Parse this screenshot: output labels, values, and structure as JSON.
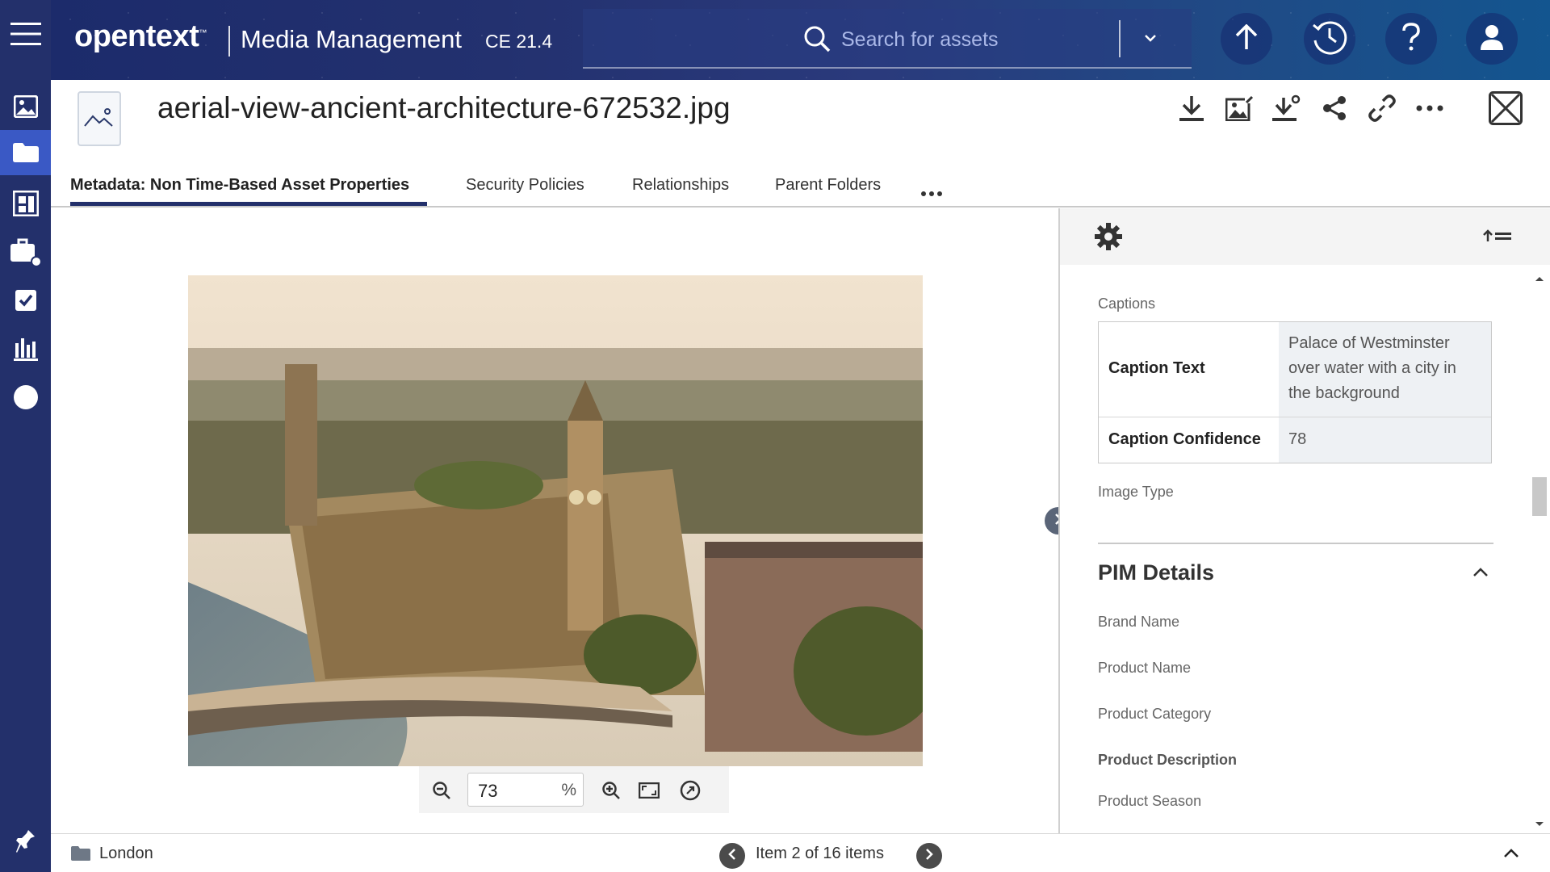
{
  "app": {
    "brand": "opentext",
    "brand_tm": "™",
    "product": "Media Management",
    "version": "CE 21.4"
  },
  "search": {
    "placeholder": "Search for assets"
  },
  "asset": {
    "title": "aerial-view-ancient-architecture-672532.jpg"
  },
  "tabs": [
    {
      "label": "Metadata: Non Time-Based Asset Properties",
      "active": true
    },
    {
      "label": "Security Policies"
    },
    {
      "label": "Relationships"
    },
    {
      "label": "Parent Folders"
    }
  ],
  "viewer": {
    "zoom_value": "73",
    "zoom_unit": "%"
  },
  "panel": {
    "captions_label": "Captions",
    "caption_rows": [
      {
        "key": "Caption Text",
        "value_lines": [
          "Palace of Westminster",
          "over water with a city in",
          "the background"
        ]
      },
      {
        "key": "Caption Confidence",
        "value": "78"
      }
    ],
    "image_type_label": "Image Type",
    "section_title": "PIM Details",
    "fields": [
      "Brand Name",
      "Product Name",
      "Product Category",
      "Product Description",
      "Product Season"
    ]
  },
  "footer": {
    "folder": "London",
    "pagination": "Item 2 of 16 items"
  },
  "colors": {
    "rail": "#23306b",
    "rail_active": "#3a59c5",
    "tab_underline": "#23306b"
  }
}
